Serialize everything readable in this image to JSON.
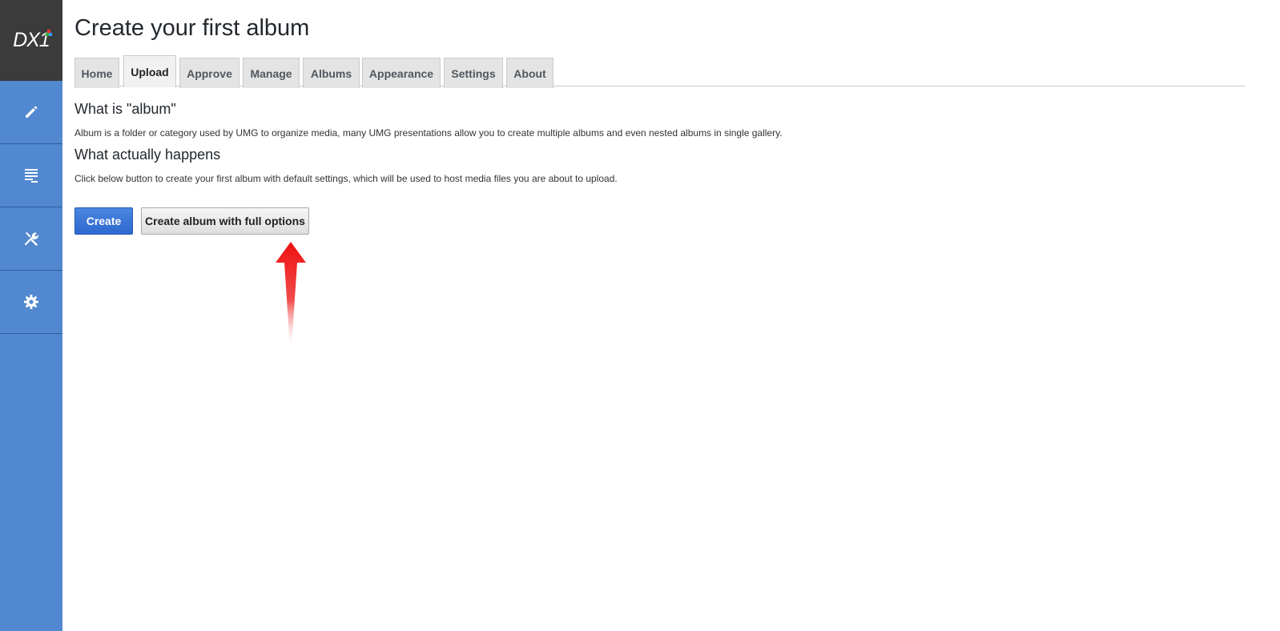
{
  "sidebar": {
    "logo_text": "DX1",
    "items": [
      {
        "icon": "pencil-icon"
      },
      {
        "icon": "list-icon"
      },
      {
        "icon": "tools-icon"
      },
      {
        "icon": "gear-icon"
      }
    ],
    "colors": {
      "background": "#5288cf",
      "logo_background": "#3b3b3b"
    }
  },
  "header": {
    "title": "Create your first album"
  },
  "tabs": [
    {
      "label": "Home",
      "active": false
    },
    {
      "label": "Upload",
      "active": true
    },
    {
      "label": "Approve",
      "active": false
    },
    {
      "label": "Manage",
      "active": false
    },
    {
      "label": "Albums",
      "active": false
    },
    {
      "label": "Appearance",
      "active": false
    },
    {
      "label": "Settings",
      "active": false
    },
    {
      "label": "About",
      "active": false
    }
  ],
  "content": {
    "what_is_heading": "What is \"album\"",
    "what_is_text": "Album is a folder or category used by UMG to organize media, many UMG presentations allow you to create multiple albums and even nested albums in single gallery.",
    "happens_heading": "What actually happens",
    "happens_text": "Click below button to create your first album with default settings, which will be used to host media files you are about to upload."
  },
  "actions": {
    "create_label": "Create",
    "create_full_label": "Create album with full options"
  },
  "annotation": {
    "arrow_color": "#ee1111",
    "arrow_icon": "red-arrow-up-icon"
  }
}
